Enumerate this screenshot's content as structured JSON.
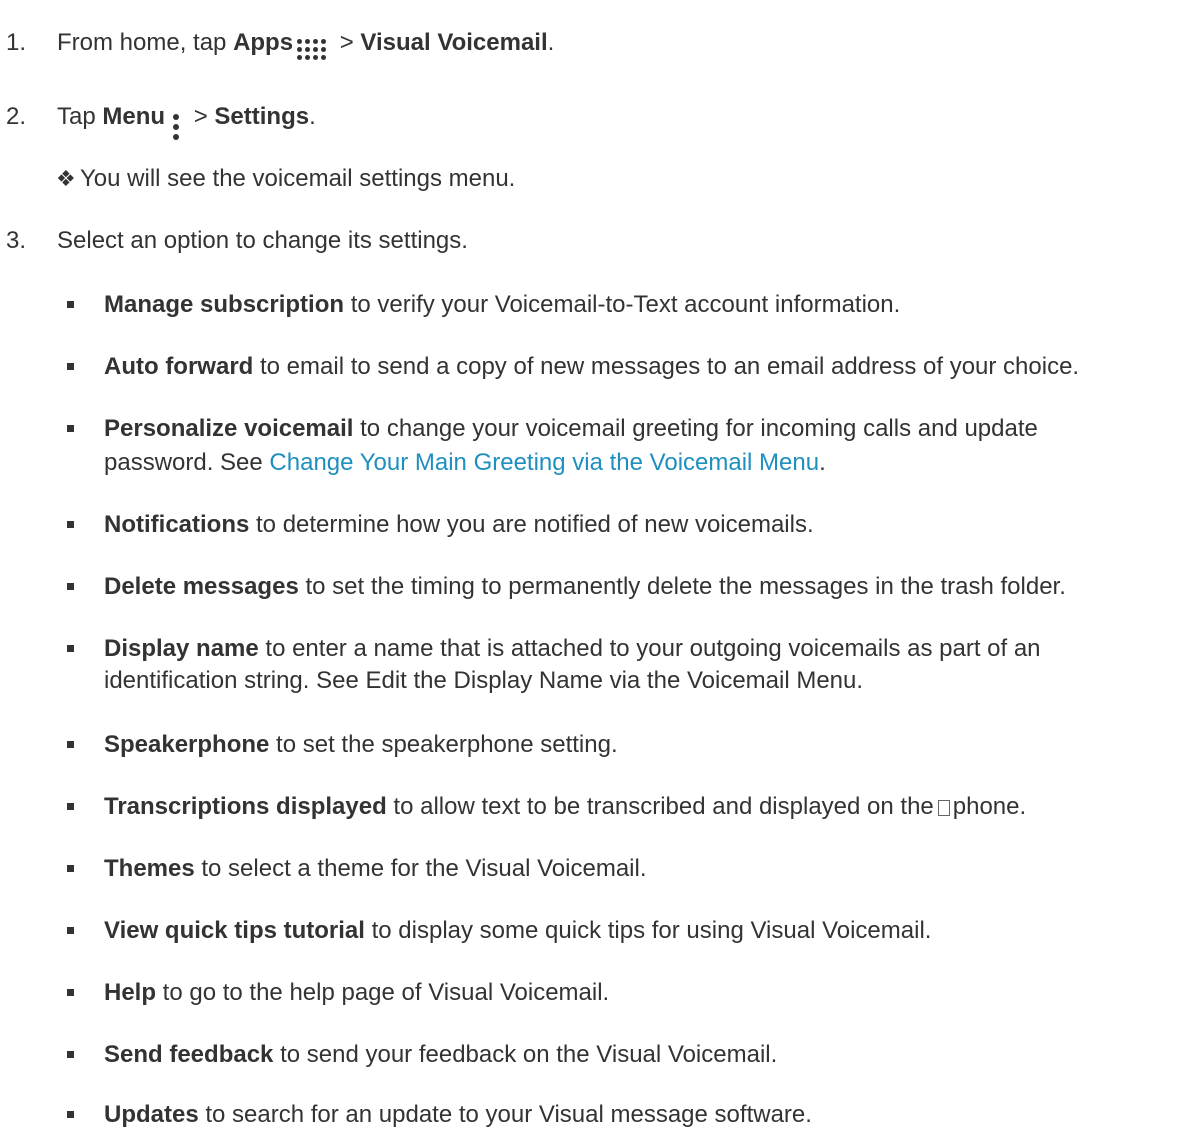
{
  "steps": [
    {
      "num": "1.",
      "pre": "From home, tap ",
      "b1": "Apps",
      "icon": "apps-grid-icon",
      "mid": " > ",
      "b2": "Visual Voicemail",
      "post": "."
    },
    {
      "num": "2.",
      "pre": "Tap ",
      "b1": "Menu",
      "icon": "menu-dots-icon",
      "mid": " > ",
      "b2": "Settings",
      "post": "."
    },
    {
      "num": "3.",
      "text": "Select an option to change its settings."
    }
  ],
  "result": {
    "glyph": "❖",
    "text": "You will see the voicemail settings menu."
  },
  "options": [
    {
      "bold": "Manage subscription",
      "rest": " to verify your Voicemail-to-Text account information."
    },
    {
      "bold": "Auto forward",
      "rest": " to email to send a copy of new messages to an email address of your choice."
    },
    {
      "bold": "Personalize voicemail",
      "rest": " to change your voicemail greeting for incoming calls and update",
      "line2_pre": "password. See ",
      "line2_link": "Change Your Main Greeting via the Voicemail Menu",
      "line2_post": "."
    },
    {
      "bold": "Notifications",
      "rest": " to determine how you are notified of new voicemails."
    },
    {
      "bold": "Delete messages",
      "rest": " to set the timing to permanently delete the messages in the trash folder."
    },
    {
      "bold": "Display name",
      "rest": " to enter a name that is attached to your outgoing voicemails as part of an",
      "line2": "identification string. See Edit the Display Name via the Voicemail Menu."
    },
    {
      "bold": "Speakerphone",
      "rest": " to set the speakerphone setting."
    },
    {
      "bold": "Transcriptions displayed",
      "rest": " to allow text to be transcribed and displayed on the",
      "rest2": "phone."
    },
    {
      "bold": "Themes",
      "rest": " to select a theme for the Visual Voicemail."
    },
    {
      "bold": "View quick tips tutorial",
      "rest": " to display some quick tips for using Visual Voicemail."
    },
    {
      "bold": "Help",
      "rest": " to go to the help page of Visual Voicemail."
    },
    {
      "bold": "Send feedback",
      "rest": " to send your feedback on the Visual Voicemail."
    },
    {
      "bold": "Updates",
      "rest": " to search for an update to your Visual message software."
    }
  ],
  "colors": {
    "text": "#333333",
    "link": "#1f8fbf"
  }
}
